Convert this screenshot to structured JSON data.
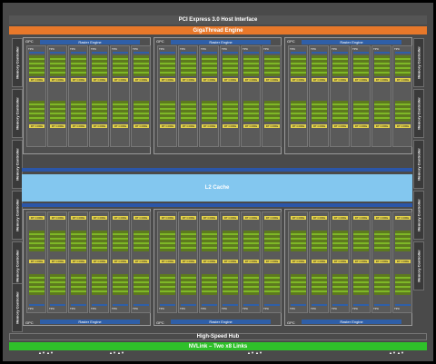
{
  "host_interface": "PCI Express 3.0 Host Interface",
  "gigathread": "GigaThread Engine",
  "memory_controller": "Memory Controller",
  "gpc_label": "GPC",
  "raster_engine": "Raster Engine",
  "tpc_label": "TPC",
  "polymorph": "PolyMorph Engine",
  "rt_core": "RT CORE",
  "sm_label": "SM",
  "l2_cache": "L2 Cache",
  "hub": "High-Speed Hub",
  "nvlink": "NVLink – Two x8 Links",
  "nvlink_port": "▲▼ ▲▼",
  "colors": {
    "host": "#555555",
    "gigathread": "#e8782a",
    "l2": "#83c7ef",
    "sm": "#5d7a1e",
    "rt": "#e3d24a",
    "nvlink": "#2fc02a",
    "raster": "#2f5fa8"
  }
}
